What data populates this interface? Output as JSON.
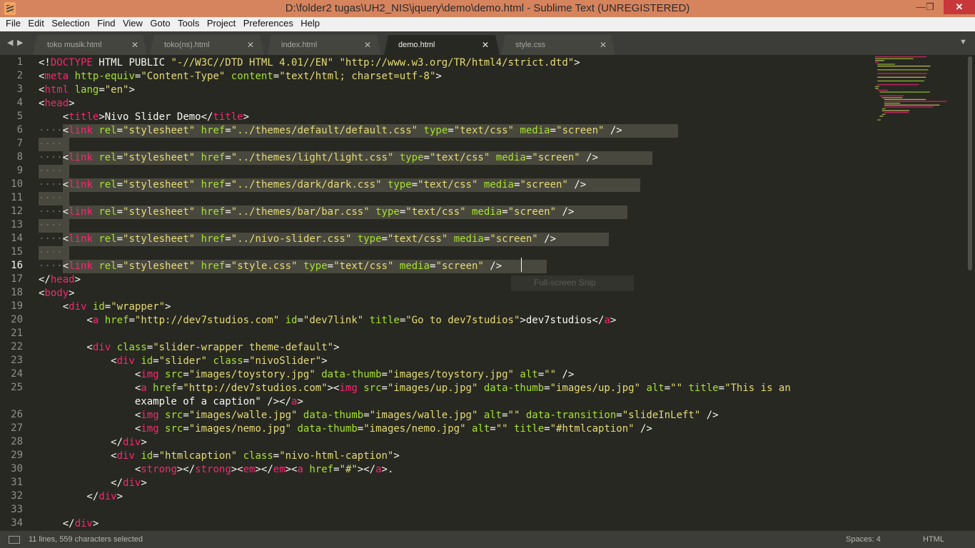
{
  "window": {
    "title": "D:\\folder2 tugas\\UH2_NIS\\jquery\\demo\\demo.html - Sublime Text (UNREGISTERED)",
    "minimize_label": "—",
    "maximize_label": "❐",
    "close_label": "✕"
  },
  "menu": [
    "File",
    "Edit",
    "Selection",
    "Find",
    "View",
    "Goto",
    "Tools",
    "Project",
    "Preferences",
    "Help"
  ],
  "tabs": [
    {
      "label": "toko musik.html",
      "active": false
    },
    {
      "label": "toko(ns).html",
      "active": false
    },
    {
      "label": "index.html",
      "active": false
    },
    {
      "label": "demo.html",
      "active": true
    },
    {
      "label": "style.css",
      "active": false
    }
  ],
  "tab_close": "✕",
  "tab_nav_left": "◀",
  "tab_nav_right": "▶",
  "tab_menu": "▼",
  "line_numbers": [
    "1",
    "2",
    "3",
    "4",
    "5",
    "6",
    "7",
    "8",
    "9",
    "10",
    "11",
    "12",
    "13",
    "14",
    "15",
    "16",
    "17",
    "18",
    "19",
    "20",
    "21",
    "22",
    "23",
    "24",
    "25",
    "",
    "26",
    "27",
    "28",
    "29",
    "30",
    "31",
    "32",
    "33",
    "34"
  ],
  "code_lines": [
    "<!DOCTYPE HTML PUBLIC \"-//W3C//DTD HTML 4.01//EN\" \"http://www.w3.org/TR/html4/strict.dtd\">",
    "<meta http-equiv=\"Content-Type\" content=\"text/html; charset=utf-8\">",
    "<html lang=\"en\">",
    "<head>",
    "    <title>Nivo Slider Demo</title>",
    "    <link rel=\"stylesheet\" href=\"../themes/default/default.css\" type=\"text/css\" media=\"screen\" />",
    "    ",
    "    <link rel=\"stylesheet\" href=\"../themes/light/light.css\" type=\"text/css\" media=\"screen\" />",
    "    ",
    "    <link rel=\"stylesheet\" href=\"../themes/dark/dark.css\" type=\"text/css\" media=\"screen\" />",
    "    ",
    "    <link rel=\"stylesheet\" href=\"../themes/bar/bar.css\" type=\"text/css\" media=\"screen\" />",
    "    ",
    "    <link rel=\"stylesheet\" href=\"../nivo-slider.css\" type=\"text/css\" media=\"screen\" />",
    "    ",
    "    <link rel=\"stylesheet\" href=\"style.css\" type=\"text/css\" media=\"screen\" />",
    "</head>",
    "<body>",
    "    <div id=\"wrapper\">",
    "        <a href=\"http://dev7studios.com\" id=\"dev7link\" title=\"Go to dev7studios\">dev7studios</a>",
    "",
    "        <div class=\"slider-wrapper theme-default\">",
    "            <div id=\"slider\" class=\"nivoSlider\">",
    "                <img src=\"images/toystory.jpg\" data-thumb=\"images/toystory.jpg\" alt=\"\" />",
    "                <a href=\"http://dev7studios.com\"><img src=\"images/up.jpg\" data-thumb=\"images/up.jpg\" alt=\"\" title=\"This is an",
    "                example of a caption\" /></a>",
    "                <img src=\"images/walle.jpg\" data-thumb=\"images/walle.jpg\" alt=\"\" data-transition=\"slideInLeft\" />",
    "                <img src=\"images/nemo.jpg\" data-thumb=\"images/nemo.jpg\" alt=\"\" title=\"#htmlcaption\" />",
    "            </div>",
    "            <div id=\"htmlcaption\" class=\"nivo-html-caption\">",
    "                <strong></strong><em></em><a href=\"#\"></a>.",
    "            </div>",
    "        </div>",
    "",
    "    </div>"
  ],
  "tooltip": "Full-screen Snip",
  "status": {
    "message": "11 lines, 559 characters selected",
    "indent": "Spaces: 4",
    "syntax": "HTML"
  },
  "colors": {
    "background": "#272822",
    "tag": "#f92672",
    "attribute": "#a6e22e",
    "string": "#e6db74",
    "text": "#f8f8f2",
    "selection": "#49483e",
    "titlebar": "#d6845e"
  }
}
